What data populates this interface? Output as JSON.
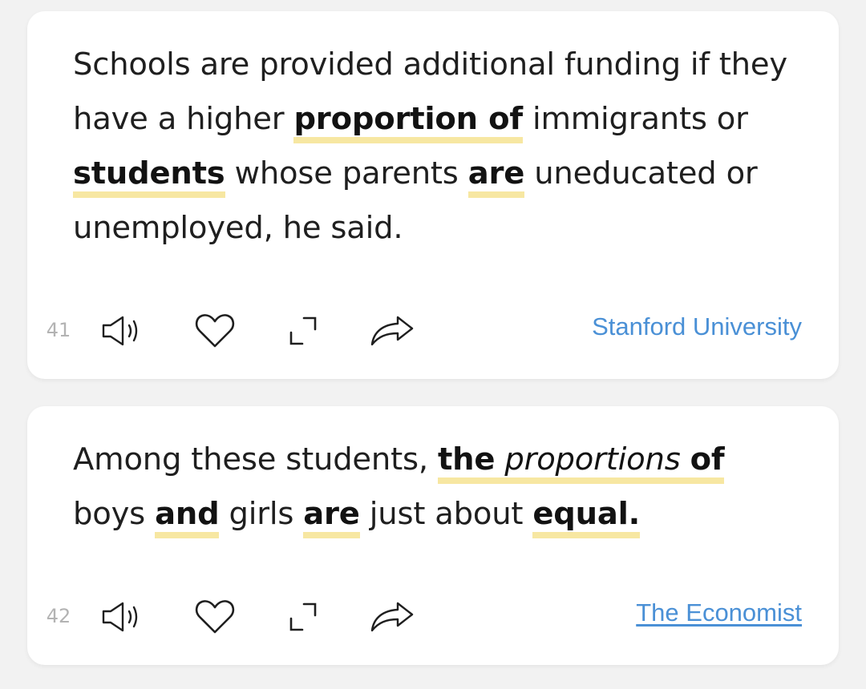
{
  "cards": [
    {
      "number": "41",
      "segments": [
        "Schools are provided additional funding if they have a higher ",
        "proportion of",
        " immigrants or ",
        "students",
        " whose parents ",
        "are",
        " uneducated or unemployed, he said."
      ],
      "source": "Stanford University"
    },
    {
      "number": "42",
      "segments": [
        "Among these students, ",
        "the",
        "proportions",
        "of",
        "boys ",
        "and",
        " girls ",
        "are",
        " just about ",
        "equal."
      ],
      "source": "The Economist"
    }
  ],
  "icons": {
    "speaker": "speaker-icon",
    "heart": "heart-icon",
    "expand": "expand-icon",
    "share": "share-icon"
  },
  "colors": {
    "highlight": "#f7e7a2",
    "source_link": "#4a90d6",
    "number": "#b3b3b3",
    "card_bg": "#ffffff",
    "page_bg": "#f2f2f2"
  }
}
